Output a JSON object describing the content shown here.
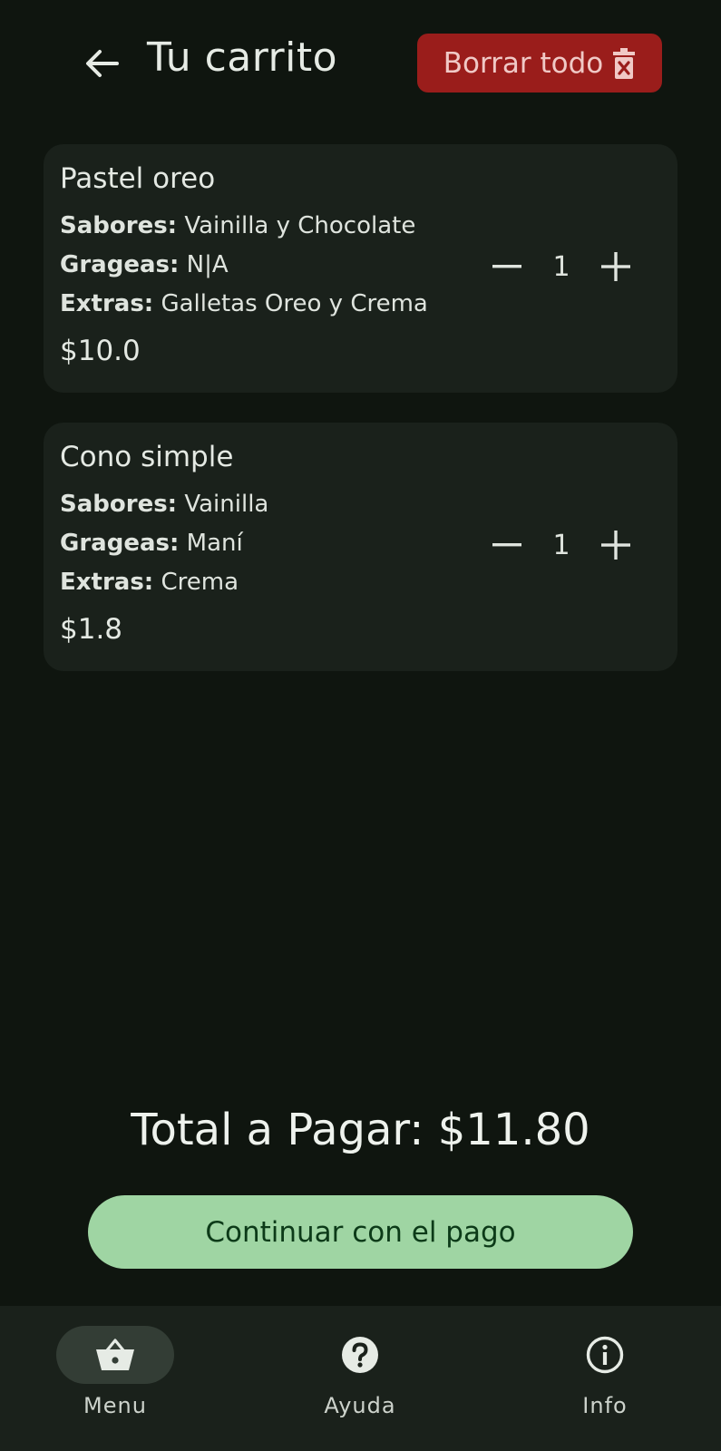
{
  "header": {
    "title": "Tu carrito",
    "back_icon": "arrow-left-icon",
    "clear_label": "Borrar todo",
    "clear_icon": "trash-x-icon"
  },
  "cart": {
    "items": [
      {
        "name": "Pastel oreo",
        "flavors_label": "Sabores:",
        "flavors": " Vainilla y Chocolate",
        "sprinkles_label": "Grageas:",
        "sprinkles": " N|A",
        "extras_label": "Extras:",
        "extras": " Galletas Oreo y Crema",
        "price": "$10.0",
        "quantity": "1"
      },
      {
        "name": "Cono simple",
        "flavors_label": "Sabores:",
        "flavors": " Vainilla",
        "sprinkles_label": "Grageas:",
        "sprinkles": " Maní",
        "extras_label": "Extras:",
        "extras": " Crema",
        "price": "$1.8",
        "quantity": "1"
      }
    ]
  },
  "summary": {
    "total_text": "Total a Pagar: $11.80",
    "pay_label": "Continuar con el pago"
  },
  "nav": {
    "items": [
      {
        "label": "Menu",
        "icon": "basket-icon",
        "active": true
      },
      {
        "label": "Ayuda",
        "icon": "help-circle-icon",
        "active": false
      },
      {
        "label": "Info",
        "icon": "info-circle-icon",
        "active": false
      }
    ]
  },
  "colors": {
    "background": "#0f150f",
    "card": "#1a211b",
    "danger": "#9a1d1b",
    "primary": "#9fd5a3"
  }
}
